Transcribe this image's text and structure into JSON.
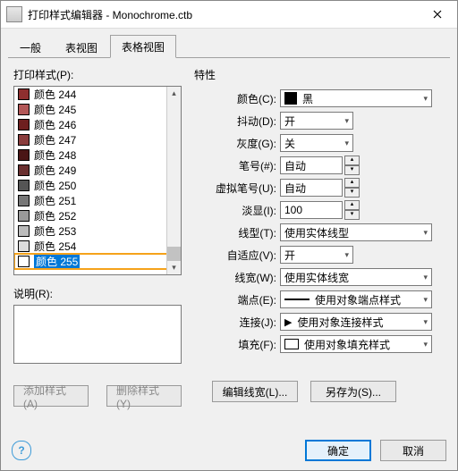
{
  "window": {
    "title": "打印样式编辑器 - Monochrome.ctb"
  },
  "tabs": {
    "t0": "一般",
    "t1": "表视图",
    "t2": "表格视图"
  },
  "left": {
    "styles_label": "打印样式(P):",
    "desc_label": "说明(R):",
    "items": [
      {
        "c": "#8e2f2f",
        "n": "颜色 244"
      },
      {
        "c": "#b25757",
        "n": "颜色 245"
      },
      {
        "c": "#6e1f1f",
        "n": "颜色 246"
      },
      {
        "c": "#8a3d3d",
        "n": "颜色 247"
      },
      {
        "c": "#4a1515",
        "n": "颜色 248"
      },
      {
        "c": "#6a3030",
        "n": "颜色 249"
      },
      {
        "c": "#555555",
        "n": "颜色 250"
      },
      {
        "c": "#777777",
        "n": "颜色 251"
      },
      {
        "c": "#999999",
        "n": "颜色 252"
      },
      {
        "c": "#bbbbbb",
        "n": "颜色 253"
      },
      {
        "c": "#dcdcdc",
        "n": "颜色 254"
      },
      {
        "c": "#ffffff",
        "n": "颜色 255"
      }
    ],
    "selected_text": "颜色 255"
  },
  "right": {
    "group": "特性",
    "color_l": "颜色(C):",
    "color_v": "黑",
    "dither_l": "抖动(D):",
    "dither_v": "开",
    "gray_l": "灰度(G):",
    "gray_v": "关",
    "pen_l": "笔号(#):",
    "pen_v": "自动",
    "vpen_l": "虚拟笔号(U):",
    "vpen_v": "自动",
    "screen_l": "淡显(I):",
    "screen_v": "100",
    "ltype_l": "线型(T):",
    "ltype_v": "使用实体线型",
    "adapt_l": "自适应(V):",
    "adapt_v": "开",
    "lw_l": "线宽(W):",
    "lw_v": "使用实体线宽",
    "end_l": "端点(E):",
    "end_v": "使用对象端点样式",
    "join_l": "连接(J):",
    "join_v": "使用对象连接样式",
    "fill_l": "填充(F):",
    "fill_v": "使用对象填充样式"
  },
  "buttons": {
    "add": "添加样式(A)",
    "del": "删除样式(Y)",
    "editlw": "编辑线宽(L)...",
    "saveas": "另存为(S)...",
    "ok": "确定",
    "cancel": "取消"
  }
}
